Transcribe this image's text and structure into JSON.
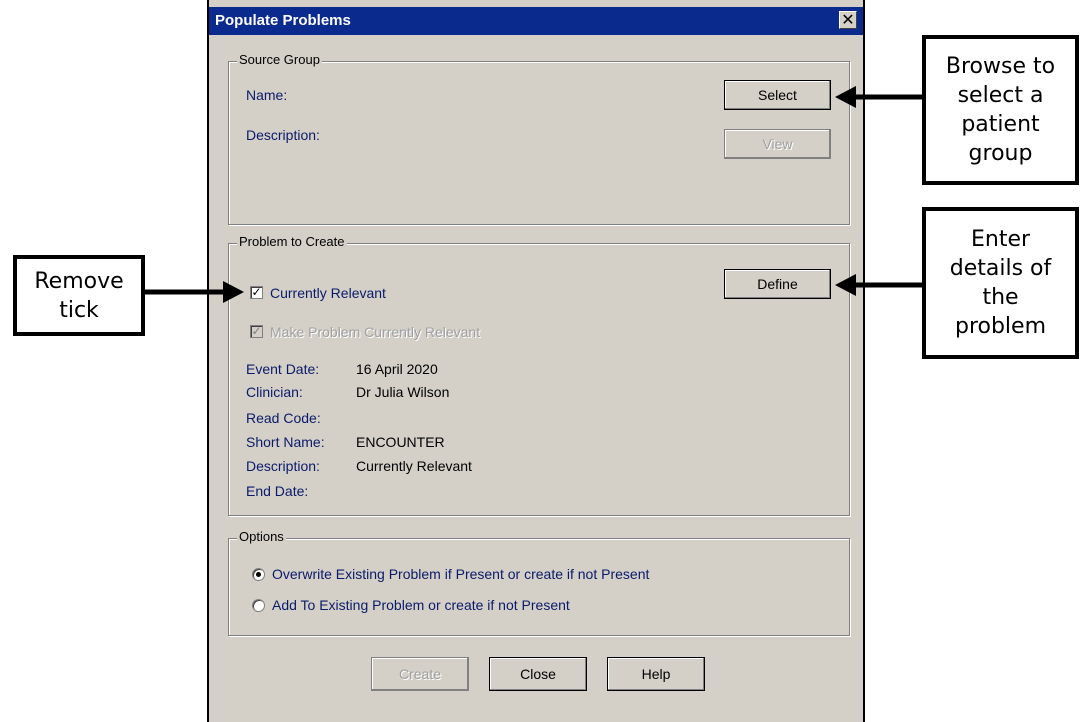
{
  "dialog": {
    "title": "Populate Problems",
    "close_glyph": "✕"
  },
  "source_group": {
    "legend": "Source Group",
    "name_label": "Name:",
    "description_label": "Description:",
    "select_label": "Select",
    "view_label": "View"
  },
  "problem": {
    "legend": "Problem to Create",
    "currently_relevant_label": "Currently Relevant",
    "currently_relevant_checked": true,
    "make_relevant_label": "Make Problem Currently Relevant",
    "make_relevant_checked": true,
    "define_label": "Define",
    "fields": [
      {
        "label": "Event Date:",
        "value": "16 April 2020"
      },
      {
        "label": "Clinician:",
        "value": "Dr Julia Wilson"
      },
      {
        "label": "Read Code:",
        "value": ""
      },
      {
        "label": "Short Name:",
        "value": "ENCOUNTER"
      },
      {
        "label": "Description:",
        "value": "Currently Relevant"
      },
      {
        "label": "End Date:",
        "value": ""
      }
    ]
  },
  "options": {
    "legend": "Options",
    "overwrite_label": "Overwrite Existing Problem if Present or create if not Present",
    "add_label": "Add To Existing Problem or create if not Present",
    "selected": "overwrite"
  },
  "footer": {
    "create_label": "Create",
    "close_label": "Close",
    "help_label": "Help"
  },
  "callouts": {
    "browse": "Browse to\nselect a\npatient\ngroup",
    "enter": "Enter\ndetails of\nthe\nproblem",
    "remove": "Remove\ntick"
  }
}
